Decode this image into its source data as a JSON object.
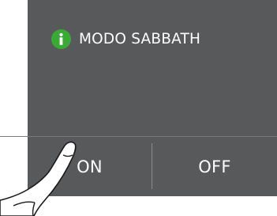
{
  "dialog": {
    "title": "MODO SABBATH",
    "icon": "info-icon",
    "accent_color": "#3aaa35",
    "background_color": "#58595b"
  },
  "buttons": {
    "on_label": "ON",
    "off_label": "OFF"
  },
  "overlay": {
    "icon": "pointing-hand-icon"
  }
}
